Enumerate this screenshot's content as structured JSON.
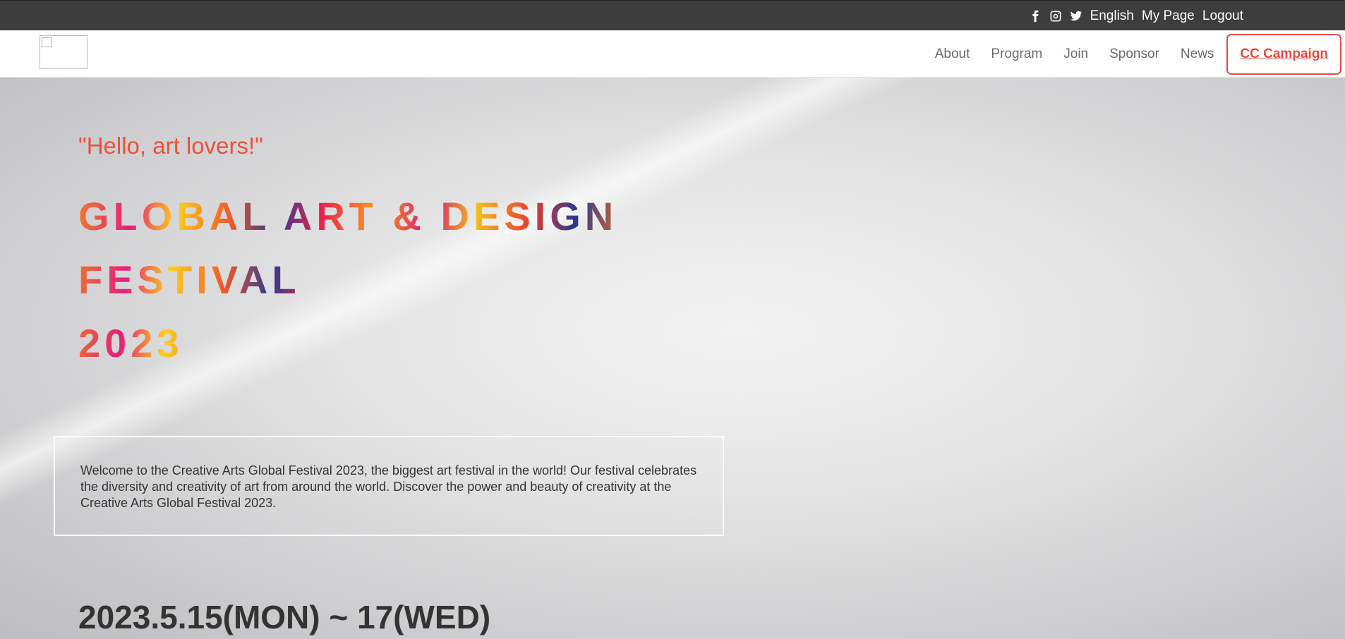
{
  "topbar": {
    "social": [
      "facebook-icon",
      "instagram-icon",
      "twitter-icon"
    ],
    "links": {
      "language": "English",
      "mypage": "My Page",
      "logout": "Logout"
    }
  },
  "nav": {
    "items": [
      "About",
      "Program",
      "Join",
      "Sponsor",
      "News"
    ],
    "cta": "CC Campaign"
  },
  "hero": {
    "greeting": "\"Hello, art lovers!\"",
    "title_lines": [
      "GLOBAL ART & DESIGN",
      "FESTIVAL",
      "2023"
    ],
    "welcome": "Welcome to the Creative Arts Global Festival 2023, the biggest art festival in the world! Our festival celebrates the diversity and creativity of art from around the world. Discover the power and beauty of creativity at the Creative Arts Global Festival 2023.",
    "date": "2023.5.15(MON) ~ 17(WED)"
  },
  "colors": {
    "accent": "#e24c40",
    "topbar": "#3d3d3d"
  }
}
